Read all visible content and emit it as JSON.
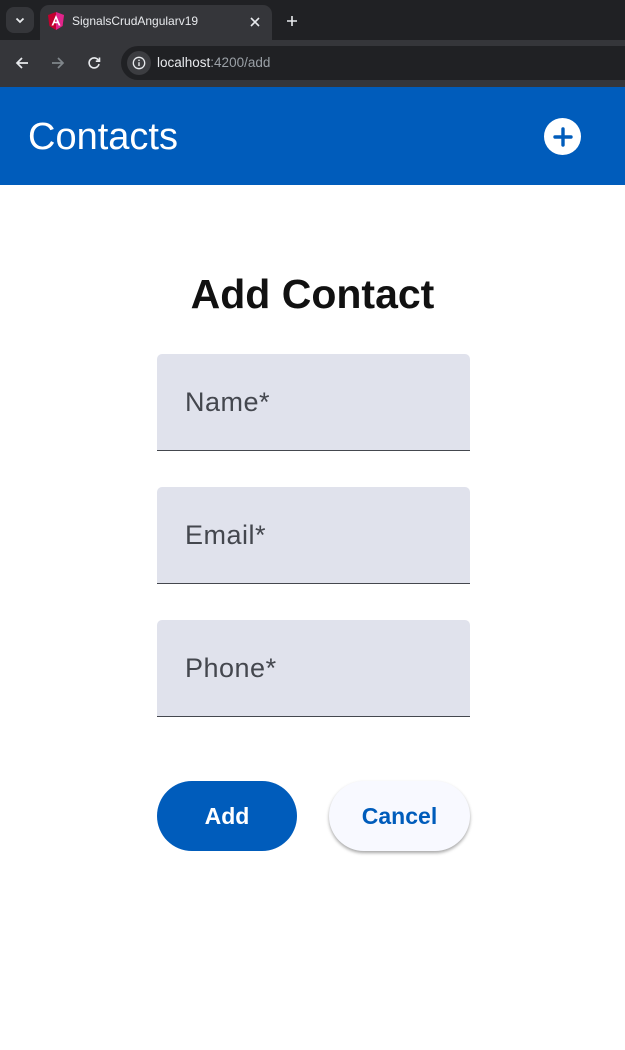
{
  "browser": {
    "tab": {
      "title": "SignalsCrudAngularv19",
      "favicon": "angular-icon",
      "close_icon": "close-icon"
    },
    "new_tab_icon": "plus-icon",
    "url": {
      "host": "localhost",
      "path": ":4200/add"
    }
  },
  "header": {
    "title": "Contacts",
    "add_icon": "plus-circle-icon"
  },
  "form": {
    "title": "Add Contact",
    "fields": {
      "name": {
        "placeholder": "Name*",
        "value": ""
      },
      "email": {
        "placeholder": "Email*",
        "value": ""
      },
      "phone": {
        "placeholder": "Phone*",
        "value": ""
      }
    },
    "add_label": "Add",
    "cancel_label": "Cancel"
  },
  "colors": {
    "primary": "#005cbb",
    "field_background": "#e0e2ec",
    "browser_dark": "#202124"
  }
}
